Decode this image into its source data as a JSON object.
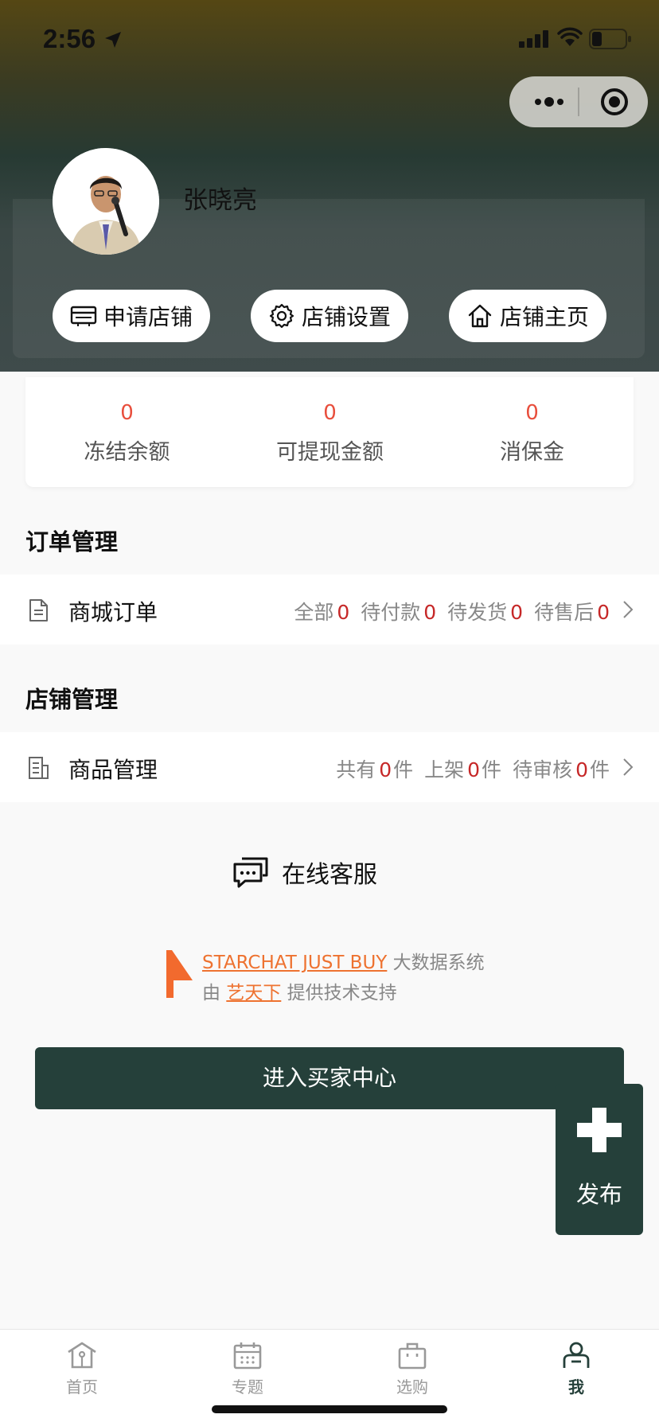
{
  "status_bar": {
    "time": "2:56"
  },
  "profile": {
    "username": "张晓亮"
  },
  "header_buttons": [
    {
      "label": "申请店铺",
      "icon": "card-icon"
    },
    {
      "label": "店铺设置",
      "icon": "gear-icon"
    },
    {
      "label": "店铺主页",
      "icon": "home-icon"
    }
  ],
  "balance": [
    {
      "value": "0",
      "label": "冻结余额"
    },
    {
      "value": "0",
      "label": "可提现金额"
    },
    {
      "value": "0",
      "label": "消保金"
    }
  ],
  "order_section": {
    "title": "订单管理",
    "row_label": "商城订单",
    "stats": [
      {
        "label": "全部",
        "count": "0"
      },
      {
        "label": "待付款",
        "count": "0"
      },
      {
        "label": "待发货",
        "count": "0"
      },
      {
        "label": "待售后",
        "count": "0"
      }
    ]
  },
  "shop_section": {
    "title": "店铺管理",
    "row_label": "商品管理",
    "stats": [
      {
        "label": "共有",
        "count": "0",
        "unit": "件"
      },
      {
        "label": "上架",
        "count": "0",
        "unit": "件"
      },
      {
        "label": "待审核",
        "count": "0",
        "unit": "件"
      }
    ]
  },
  "online_service": {
    "label": "在线客服"
  },
  "powered_by": {
    "brand_link": "STARCHAT JUST BUY",
    "brand_suffix": "大数据系统",
    "prefix": "由",
    "company_link": "艺天下",
    "suffix": "提供技术支持"
  },
  "buyer_center_button": "进入买家中心",
  "publish_button": "发布",
  "tabbar": [
    {
      "label": "首页",
      "icon": "home-tab-icon",
      "active": false
    },
    {
      "label": "专题",
      "icon": "calendar-tab-icon",
      "active": false
    },
    {
      "label": "选购",
      "icon": "bag-tab-icon",
      "active": false
    },
    {
      "label": "我",
      "icon": "user-tab-icon",
      "active": true
    }
  ],
  "colors": {
    "accent": "#25403a",
    "number_red": "#c62828",
    "balance_red": "#e84e3c",
    "link_orange": "#ee7230"
  }
}
